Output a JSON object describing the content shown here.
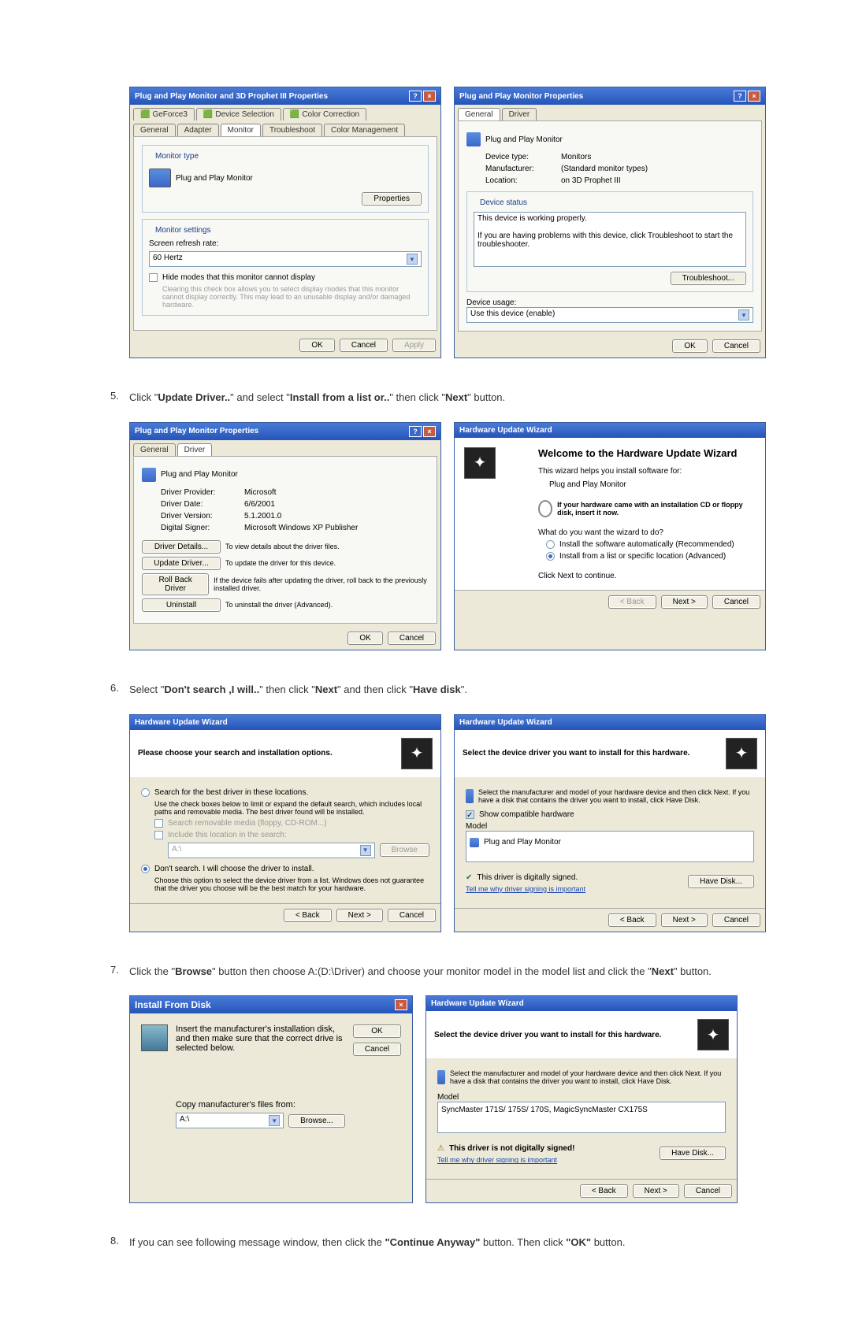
{
  "steps": {
    "s5": {
      "num": "5.",
      "text_a": "Click \"",
      "t1": "Update Driver..",
      "text_b": "\" and select \"",
      "t2": "Install from a list or..",
      "text_c": "\" then click \"",
      "t3": "Next",
      "text_d": "\" button."
    },
    "s6": {
      "num": "6.",
      "text_a": "Select \"",
      "t1": "Don't search ,I will..",
      "text_b": "\" then click \"",
      "t2": "Next",
      "text_c": "\" and then click \"",
      "t3": "Have disk",
      "text_d": "\"."
    },
    "s7": {
      "num": "7.",
      "text_a": "Click the \"",
      "t1": "Browse",
      "text_b": "\" button then choose A:(D:\\Driver) and choose your monitor model in the model list and click the \"",
      "t2": "Next",
      "text_c": "\" button."
    },
    "s8": {
      "num": "8.",
      "text_a": "If you can see following message window, then click the ",
      "t1": "\"Continue Anyway\"",
      "text_b": " button. Then click ",
      "t2": "\"OK\"",
      "text_c": " button."
    }
  },
  "dlg1": {
    "title": "Plug and Play Monitor and 3D Prophet III Properties",
    "tabs": {
      "geforce": "GeForce3",
      "devsel": "Device Selection",
      "colorcorr": "Color Correction",
      "general": "General",
      "adapter": "Adapter",
      "monitor": "Monitor",
      "trouble": "Troubleshoot",
      "colormgmt": "Color Management"
    },
    "montype": "Monitor type",
    "monname": "Plug and Play Monitor",
    "props": "Properties",
    "monset": "Monitor settings",
    "refresh": "Screen refresh rate:",
    "hz": "60 Hertz",
    "hide": "Hide modes that this monitor cannot display",
    "hidedesc": "Clearing this check box allows you to select display modes that this monitor cannot display correctly. This may lead to an unusable display and/or damaged hardware.",
    "ok": "OK",
    "cancel": "Cancel",
    "apply": "Apply"
  },
  "dlg2": {
    "title": "Plug and Play Monitor Properties",
    "tabs": {
      "general": "General",
      "driver": "Driver"
    },
    "name": "Plug and Play Monitor",
    "devtype_l": "Device type:",
    "devtype": "Monitors",
    "manuf_l": "Manufacturer:",
    "manuf": "(Standard monitor types)",
    "loc_l": "Location:",
    "loc": "on 3D Prophet III",
    "devstatus": "Device status",
    "working": "This device is working properly.",
    "ifprob": "If you are having problems with this device, click Troubleshoot to start the troubleshooter.",
    "tshoot": "Troubleshoot...",
    "usage": "Device usage:",
    "usageval": "Use this device (enable)",
    "ok": "OK",
    "cancel": "Cancel"
  },
  "dlg3": {
    "title": "Plug and Play Monitor Properties",
    "tabs": {
      "general": "General",
      "driver": "Driver"
    },
    "name": "Plug and Play Monitor",
    "prov_l": "Driver Provider:",
    "prov": "Microsoft",
    "date_l": "Driver Date:",
    "date": "6/6/2001",
    "ver_l": "Driver Version:",
    "ver": "5.1.2001.0",
    "sign_l": "Digital Signer:",
    "sign": "Microsoft Windows XP Publisher",
    "btn_det": "Driver Details...",
    "det_desc": "To view details about the driver files.",
    "btn_upd": "Update Driver...",
    "upd_desc": "To update the driver for this device.",
    "btn_roll": "Roll Back Driver",
    "roll_desc": "If the device fails after updating the driver, roll back to the previously installed driver.",
    "btn_un": "Uninstall",
    "un_desc": "To uninstall the driver (Advanced).",
    "ok": "OK",
    "cancel": "Cancel"
  },
  "wiz1": {
    "title": "Hardware Update Wizard",
    "welcome": "Welcome to the Hardware Update Wizard",
    "helps": "This wizard helps you install software for:",
    "dev": "Plug and Play Monitor",
    "cd": "If your hardware came with an installation CD or floppy disk, insert it now.",
    "want": "What do you want the wizard to do?",
    "opt1": "Install the software automatically (Recommended)",
    "opt2": "Install from a list or specific location (Advanced)",
    "cont": "Click Next to continue.",
    "back": "< Back",
    "next": "Next >",
    "cancel": "Cancel"
  },
  "wiz2": {
    "title": "Hardware Update Wizard",
    "head": "Please choose your search and installation options.",
    "opt_search": "Search for the best driver in these locations.",
    "opt_search_desc": "Use the check boxes below to limit or expand the default search, which includes local paths and removable media. The best driver found will be installed.",
    "chk1": "Search removable media (floppy, CD-ROM...)",
    "chk2": "Include this location in the search:",
    "loc": "A:\\",
    "browse": "Browse",
    "opt_dont": "Don't search. I will choose the driver to install.",
    "opt_dont_desc": "Choose this option to select the device driver from a list. Windows does not guarantee that the driver you choose will be the best match for your hardware.",
    "back": "< Back",
    "next": "Next >",
    "cancel": "Cancel"
  },
  "wiz3": {
    "title": "Hardware Update Wizard",
    "head": "Select the device driver you want to install for this hardware.",
    "desc": "Select the manufacturer and model of your hardware device and then click Next. If you have a disk that contains the driver you want to install, click Have Disk.",
    "show": "Show compatible hardware",
    "model": "Model",
    "item": "Plug and Play Monitor",
    "signed": "This driver is digitally signed.",
    "tell": "Tell me why driver signing is important",
    "have": "Have Disk...",
    "back": "< Back",
    "next": "Next >",
    "cancel": "Cancel"
  },
  "dlg_ifd": {
    "title": "Install From Disk",
    "instr": "Insert the manufacturer's installation disk, and then make sure that the correct drive is selected below.",
    "ok": "OK",
    "cancel": "Cancel",
    "copy": "Copy manufacturer's files from:",
    "val": "A:\\",
    "browse": "Browse..."
  },
  "wiz4": {
    "title": "Hardware Update Wizard",
    "head": "Select the device driver you want to install for this hardware.",
    "desc": "Select the manufacturer and model of your hardware device and then click Next. If you have a disk that contains the driver you want to install, click Have Disk.",
    "model": "Model",
    "item": "SyncMaster 171S/ 175S/ 170S, MagicSyncMaster CX175S",
    "notsigned": "This driver is not digitally signed!",
    "tell": "Tell me why driver signing is important",
    "have": "Have Disk...",
    "back": "< Back",
    "next": "Next >",
    "cancel": "Cancel"
  }
}
